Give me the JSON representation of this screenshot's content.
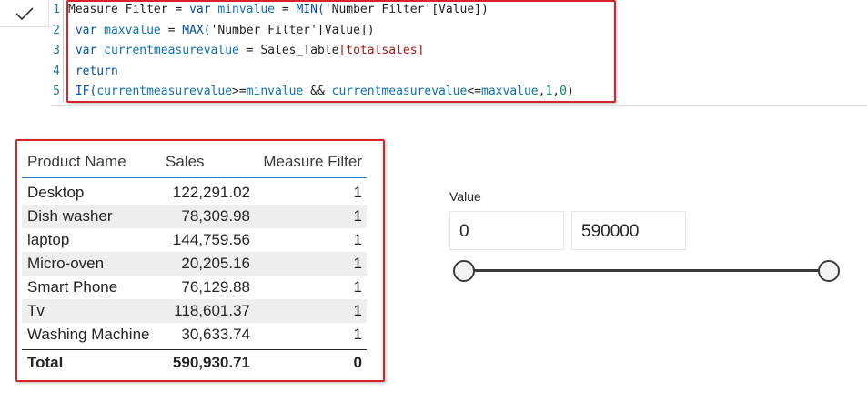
{
  "formula_bar": {
    "commit_icon": "checkmark-icon",
    "lines": [
      {
        "num": "1",
        "indent": "",
        "tokens": [
          {
            "t": "Measure Filter = ",
            "c": "txt"
          },
          {
            "t": "var ",
            "c": "kw"
          },
          {
            "t": "minvalue",
            "c": "vr"
          },
          {
            "t": " = ",
            "c": "txt"
          },
          {
            "t": "MIN(",
            "c": "kw"
          },
          {
            "t": "'Number Filter'[Value]",
            "c": "txt"
          },
          {
            "t": ")",
            "c": "txt"
          }
        ]
      },
      {
        "num": "2",
        "indent": " ",
        "tokens": [
          {
            "t": "var ",
            "c": "kw"
          },
          {
            "t": "maxvalue",
            "c": "vr"
          },
          {
            "t": " = ",
            "c": "txt"
          },
          {
            "t": "MAX(",
            "c": "kw"
          },
          {
            "t": "'Number Filter'[Value]",
            "c": "txt"
          },
          {
            "t": ")",
            "c": "txt"
          }
        ]
      },
      {
        "num": "3",
        "indent": " ",
        "tokens": [
          {
            "t": "var ",
            "c": "kw"
          },
          {
            "t": "currentmeasurevalue",
            "c": "vr"
          },
          {
            "t": " = ",
            "c": "txt"
          },
          {
            "t": "Sales_Table",
            "c": "txt"
          },
          {
            "t": "[totalsales]",
            "c": "st"
          }
        ]
      },
      {
        "num": "4",
        "indent": " ",
        "tokens": [
          {
            "t": "return",
            "c": "kw"
          }
        ]
      },
      {
        "num": "5",
        "indent": " ",
        "tokens": [
          {
            "t": "IF(",
            "c": "kw"
          },
          {
            "t": "currentmeasurevalue",
            "c": "vr"
          },
          {
            "t": ">=",
            "c": "txt"
          },
          {
            "t": "minvalue",
            "c": "vr"
          },
          {
            "t": " && ",
            "c": "txt"
          },
          {
            "t": "currentmeasurevalue",
            "c": "vr"
          },
          {
            "t": "<=",
            "c": "txt"
          },
          {
            "t": "maxvalue",
            "c": "vr"
          },
          {
            "t": ",",
            "c": "txt"
          },
          {
            "t": "1",
            "c": "num"
          },
          {
            "t": ",",
            "c": "txt"
          },
          {
            "t": "0",
            "c": "num"
          },
          {
            "t": ")",
            "c": "txt"
          }
        ]
      }
    ]
  },
  "table": {
    "headers": [
      "Product Name",
      "Sales",
      "Measure Filter"
    ],
    "rows": [
      [
        "Desktop",
        "122,291.02",
        "1"
      ],
      [
        "Dish washer",
        "78,309.98",
        "1"
      ],
      [
        "laptop",
        "144,759.56",
        "1"
      ],
      [
        "Micro-oven",
        "20,205.16",
        "1"
      ],
      [
        "Smart Phone",
        "76,129.88",
        "1"
      ],
      [
        "Tv",
        "118,601.37",
        "1"
      ],
      [
        "Washing Machine",
        "30,633.74",
        "1"
      ]
    ],
    "total": [
      "Total",
      "590,930.71",
      "0"
    ]
  },
  "slicer": {
    "title": "Value",
    "min_value": "0",
    "max_value": "590000"
  },
  "colors": {
    "highlight_border": "#d9232b",
    "header_rule": "#2b7bc4"
  }
}
